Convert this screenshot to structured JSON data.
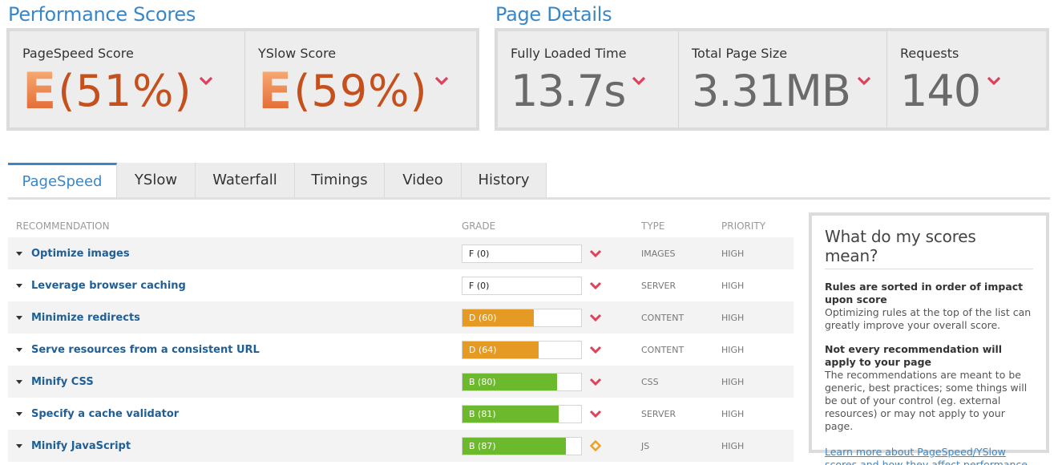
{
  "performance": {
    "title": "Performance Scores",
    "pagespeed": {
      "label": "PageSpeed Score",
      "grade": "E",
      "percent": "(51%)"
    },
    "yslow": {
      "label": "YSlow Score",
      "grade": "E",
      "percent": "(59%)"
    }
  },
  "details": {
    "title": "Page Details",
    "load_time": {
      "label": "Fully Loaded Time",
      "value": "13.7s"
    },
    "page_size": {
      "label": "Total Page Size",
      "value": "3.31MB"
    },
    "requests": {
      "label": "Requests",
      "value": "140"
    }
  },
  "tabs": [
    {
      "label": "PageSpeed",
      "active": true
    },
    {
      "label": "YSlow"
    },
    {
      "label": "Waterfall"
    },
    {
      "label": "Timings"
    },
    {
      "label": "Video"
    },
    {
      "label": "History"
    }
  ],
  "table": {
    "headers": {
      "recommendation": "RECOMMENDATION",
      "grade": "GRADE",
      "type": "TYPE",
      "priority": "PRIORITY"
    },
    "rows": [
      {
        "name": "Optimize images",
        "grade": "F (0)",
        "score": 0,
        "type": "IMAGES",
        "priority": "HIGH",
        "icon": "chevron-down-icon"
      },
      {
        "name": "Leverage browser caching",
        "grade": "F (0)",
        "score": 0,
        "type": "SERVER",
        "priority": "HIGH",
        "icon": "chevron-down-icon"
      },
      {
        "name": "Minimize redirects",
        "grade": "D (60)",
        "score": 60,
        "type": "CONTENT",
        "priority": "HIGH",
        "icon": "chevron-down-icon"
      },
      {
        "name": "Serve resources from a consistent URL",
        "grade": "D (64)",
        "score": 64,
        "type": "CONTENT",
        "priority": "HIGH",
        "icon": "chevron-down-icon"
      },
      {
        "name": "Minify CSS",
        "grade": "B (80)",
        "score": 80,
        "type": "CSS",
        "priority": "HIGH",
        "icon": "chevron-down-icon"
      },
      {
        "name": "Specify a cache validator",
        "grade": "B (81)",
        "score": 81,
        "type": "SERVER",
        "priority": "HIGH",
        "icon": "chevron-down-icon"
      },
      {
        "name": "Minify JavaScript",
        "grade": "B (87)",
        "score": 87,
        "type": "JS",
        "priority": "HIGH",
        "icon": "diamond-icon"
      }
    ]
  },
  "sidebar": {
    "title": "What do my scores mean?",
    "h1": "Rules are sorted in order of impact upon score",
    "p1": "Optimizing rules at the top of the list can greatly improve your overall score.",
    "h2": "Not every recommendation will apply to your page",
    "p2": "The recommendations are meant to be generic, best practices; some things will be out of your control (eg. external resources) or may not apply to your page.",
    "link": "Learn more about PageSpeed/YSlow scores and how they affect performance."
  },
  "colors": {
    "accent": "#3a87c8",
    "grade_d": "#e59a23",
    "grade_b": "#6cb92e",
    "chevron": "#e0405a",
    "diamond": "#f0a020"
  }
}
